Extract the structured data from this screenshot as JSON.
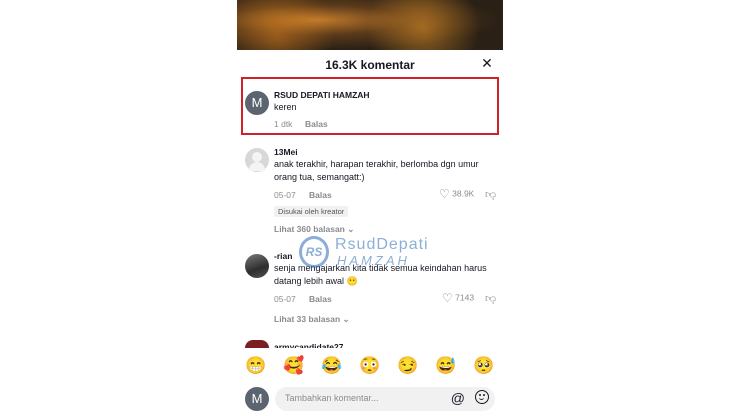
{
  "header": {
    "title": "16.3K komentar",
    "close": "✕"
  },
  "comments": [
    {
      "avatar_letter": "M",
      "name": "RSUD DEPATI HAMZAH",
      "text": "keren",
      "time": "1 dtk",
      "reply": "Balas"
    },
    {
      "name": "13Mei",
      "text": "anak terakhir, harapan terakhir, berlomba dgn umur orang tua, semangatt:)",
      "time": "05-07",
      "reply": "Balas",
      "likes": "38.9K",
      "creator_tag": "Disukai oleh kreator",
      "view_replies": "Lihat 360 balasan ⌄"
    },
    {
      "name": "-rian",
      "text": "senja mengajarkan kita tidak semua keindahan harus datang lebih awal 😶",
      "time": "05-07",
      "reply": "Balas",
      "likes": "7143",
      "view_replies": "Lihat 33 balasan ⌄"
    }
  ],
  "partial_next_name": "armycandidate27",
  "watermark": {
    "logo": "RS",
    "top": "RsudDepati",
    "bottom": "HAMZAH"
  },
  "emojis": [
    "😁",
    "🥰",
    "😂",
    "😳",
    "😏",
    "😅",
    "🥺"
  ],
  "input": {
    "avatar_letter": "M",
    "placeholder": "Tambahkan komentar...",
    "at": "@"
  },
  "icons": {
    "heart": "heart-outline-icon",
    "dislike": "thumbs-down-icon",
    "close": "close-icon"
  },
  "colors": {
    "highlight": "#d0202a",
    "watermark": "#2f6db5"
  }
}
